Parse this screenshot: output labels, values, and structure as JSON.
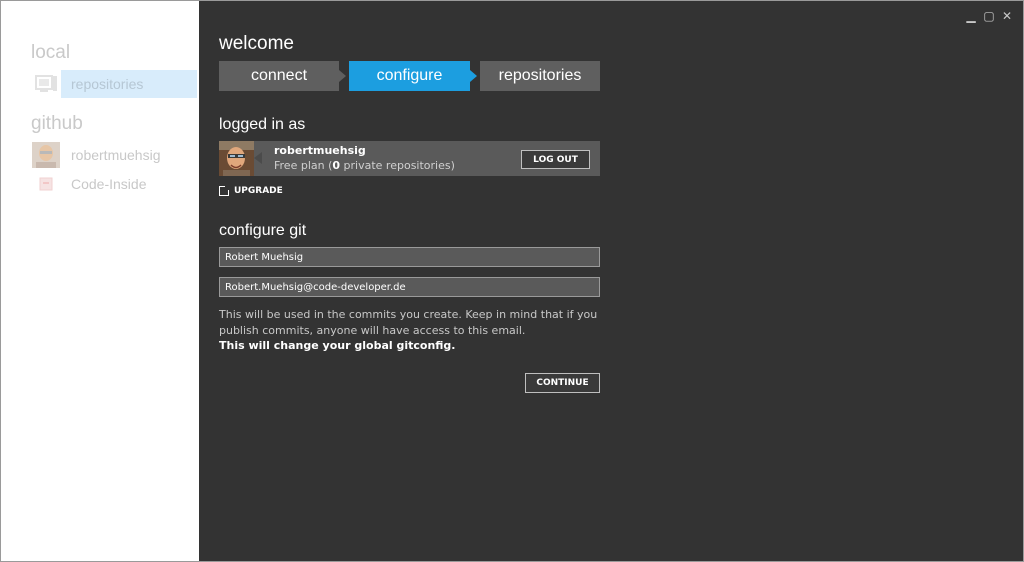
{
  "window": {
    "controls": {
      "minimize": "▁",
      "maximize": "▢",
      "close": "✕"
    }
  },
  "sidebar": {
    "local_heading": "local",
    "local_items": [
      {
        "label": "repositories",
        "icon": "computer-icon",
        "active": true
      }
    ],
    "github_heading": "github",
    "github_items": [
      {
        "label": "robertmuehsig",
        "icon": "user-avatar"
      },
      {
        "label": "Code-Inside",
        "icon": "organization-icon"
      }
    ]
  },
  "main": {
    "title": "welcome",
    "steps": [
      {
        "label": "connect",
        "active": false
      },
      {
        "label": "configure",
        "active": true
      },
      {
        "label": "repositories",
        "active": false
      }
    ],
    "logged_in_heading": "logged in as",
    "user": {
      "name": "robertmuehsig",
      "plan_prefix": "Free plan (",
      "private_count": "0",
      "plan_suffix": " private repositories)",
      "logout_label": "LOG OUT"
    },
    "upgrade_label": "UPGRADE",
    "configure_heading": "configure git",
    "git": {
      "name_value": "Robert Muehsig",
      "email_value": "Robert.Muehsig@code-developer.de"
    },
    "note": "This will be used in the commits you create. Keep in mind that if you publish commits, anyone will have access to this email.",
    "note_strong": "This will change your global gitconfig.",
    "continue_label": "CONTINUE"
  },
  "colors": {
    "accent": "#1c9ee0",
    "panel": "#333333",
    "step_inactive": "#5f5f5f",
    "sidebar_active": "#d8ecfb"
  }
}
